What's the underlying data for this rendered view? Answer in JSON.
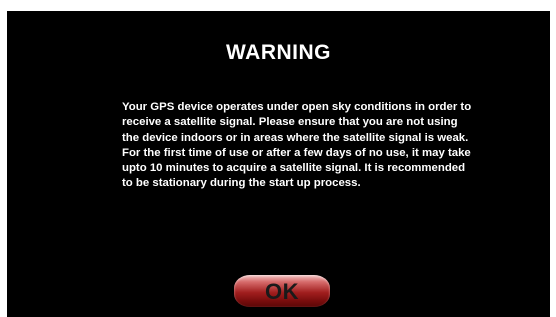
{
  "dialog": {
    "title": "WARNING",
    "paragraph1": "Your GPS device operates under open sky conditions in order to receive a satellite signal. Please ensure that you are not using the device indoors or in areas where the satellite signal is weak.",
    "paragraph2": "For the first time of use or after a few days of no use, it may take upto 10 minutes to acquire a satellite signal. It is recommended to be stationary during the start up process.",
    "ok_label": "OK"
  },
  "colors": {
    "screen_background": "#000000",
    "text": "#ffffff",
    "button_accent": "#a11e1e"
  }
}
